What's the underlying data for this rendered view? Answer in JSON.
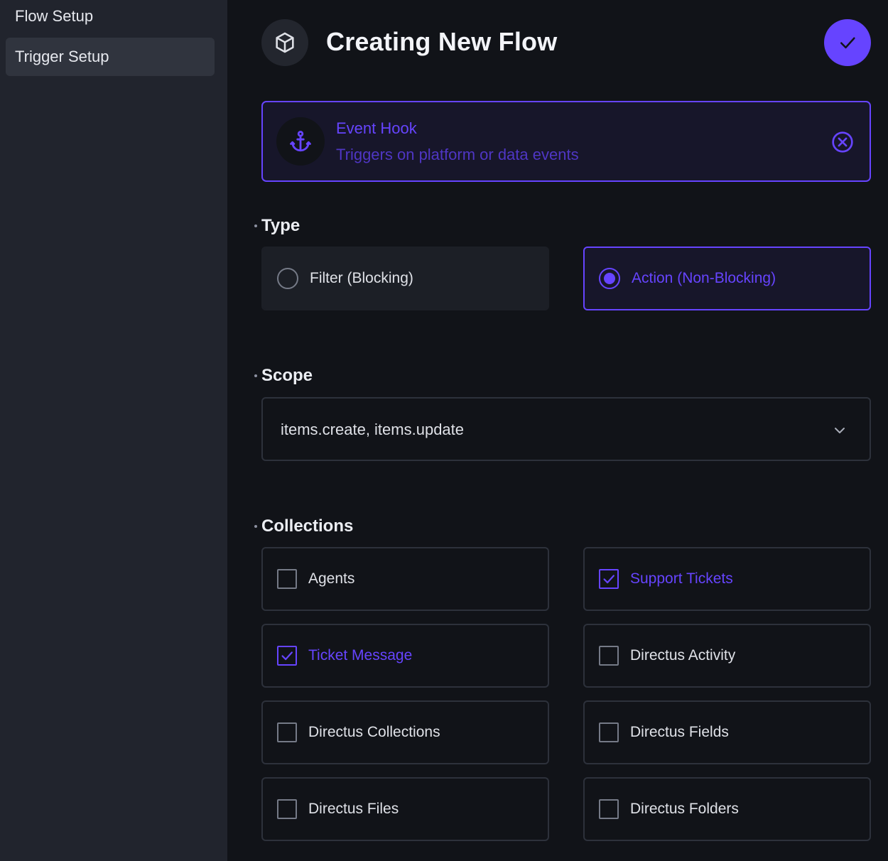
{
  "sidebar": {
    "items": [
      {
        "label": "Flow Setup"
      },
      {
        "label": "Trigger Setup"
      }
    ]
  },
  "header": {
    "title": "Creating New Flow",
    "icon": "cube-icon",
    "save_icon": "check-icon"
  },
  "trigger": {
    "name": "Event Hook",
    "description": "Triggers on platform or data events",
    "icon": "anchor-icon",
    "close_icon": "close-circle-icon"
  },
  "type": {
    "label": "Type",
    "options": [
      {
        "label": "Filter (Blocking)",
        "selected": false
      },
      {
        "label": "Action (Non-Blocking)",
        "selected": true
      }
    ]
  },
  "scope": {
    "label": "Scope",
    "value": "items.create, items.update"
  },
  "collections": {
    "label": "Collections",
    "items": [
      {
        "label": "Agents",
        "checked": false
      },
      {
        "label": "Support Tickets",
        "checked": true
      },
      {
        "label": "Ticket Message",
        "checked": true
      },
      {
        "label": "Directus Activity",
        "checked": false
      },
      {
        "label": "Directus Collections",
        "checked": false
      },
      {
        "label": "Directus Fields",
        "checked": false
      },
      {
        "label": "Directus Files",
        "checked": false
      },
      {
        "label": "Directus Folders",
        "checked": false
      }
    ]
  },
  "colors": {
    "accent": "#6644ff",
    "background": "#111318",
    "sidebar": "#21242d"
  }
}
